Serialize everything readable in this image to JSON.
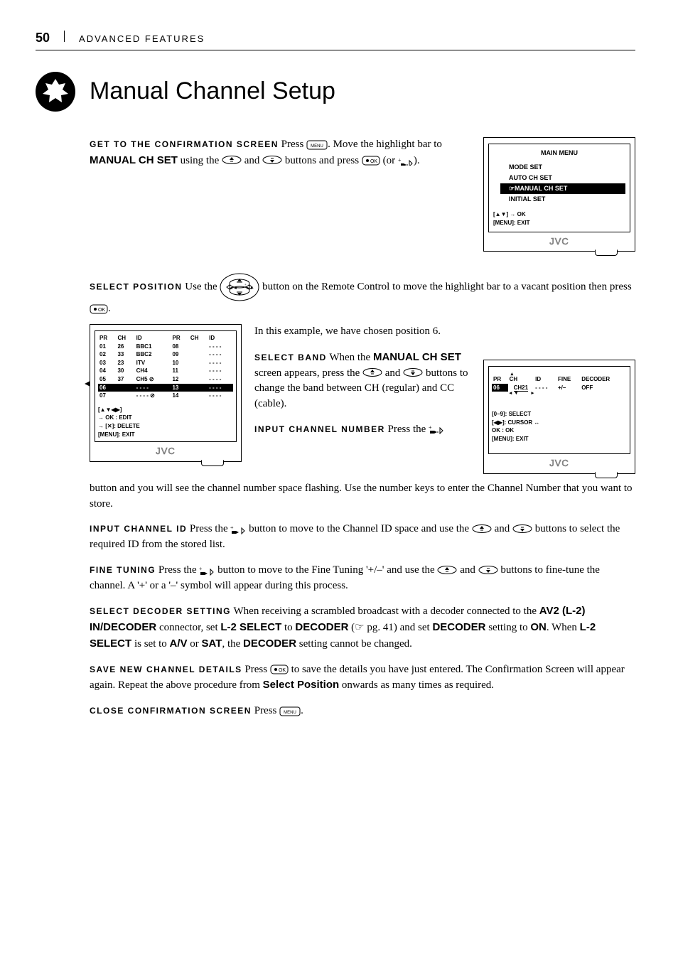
{
  "header": {
    "page_number": "50",
    "section": "ADVANCED FEATURES"
  },
  "title": "Manual Channel Setup",
  "step1": {
    "lead": "GET TO THE CONFIRMATION SCREEN",
    "t1": "Press ",
    "t2": ". Move the highlight bar to ",
    "bold1": "MANUAL CH SET",
    "t3": " using the ",
    "t4": " and ",
    "t5": " buttons and press ",
    "t6": " (or ",
    "t7": ")."
  },
  "screen_main": {
    "title": "MAIN MENU",
    "items": [
      "MODE SET",
      "AUTO CH SET",
      "MANUAL CH SET",
      "INITIAL SET"
    ],
    "hint1": "[▲▼] → OK",
    "hint2": "[MENU]: EXIT",
    "logo": "JVC"
  },
  "step2": {
    "lead": "SELECT POSITION",
    "t1": "Use the ",
    "t2": " button on the Remote Control to move the highlight bar to a vacant position then press ",
    "t3": ".",
    "t4": "In this example, we have chosen position 6."
  },
  "screen_list": {
    "headers": [
      "PR",
      "CH",
      "ID",
      "PR",
      "CH",
      "ID"
    ],
    "rows": [
      [
        "01",
        "26",
        "BBC1",
        "08",
        "",
        "- - - -"
      ],
      [
        "02",
        "33",
        "BBC2",
        "09",
        "",
        "- - - -"
      ],
      [
        "03",
        "23",
        "ITV",
        "10",
        "",
        "- - - -"
      ],
      [
        "04",
        "30",
        "CH4",
        "11",
        "",
        "- - - -"
      ],
      [
        "05",
        "37",
        "CH5 ⊘",
        "12",
        "",
        "- - - -"
      ]
    ],
    "hl_row": [
      "06",
      "",
      "- - - -",
      "13",
      "",
      "- - - -"
    ],
    "last_row": [
      "07",
      "",
      "- - - - ⊘",
      "14",
      "",
      "- - - -"
    ],
    "hint1": "[▲▼◀▶]",
    "hint2": "→ OK : EDIT",
    "hint3": "→ [✕]: DELETE",
    "hint4": "[MENU]: EXIT",
    "logo": "JVC"
  },
  "step3": {
    "lead": "SELECT BAND",
    "t1": "When the ",
    "bold1": "MANUAL CH SET",
    "t2": " screen appears, press the ",
    "t3": " and ",
    "t4": " buttons to change the band between CH (regular) and CC (cable)."
  },
  "step4": {
    "lead": "INPUT CHANNEL NUMBER",
    "t1": "Press the ",
    "t2": " button and you will see the channel number space flashing. Use the number keys to enter the Channel Number that you want to store."
  },
  "screen_edit": {
    "headers": [
      "PR",
      "CH",
      "ID",
      "FINE",
      "DECODER"
    ],
    "row": [
      "06",
      "CH21",
      "- - - -",
      "+/–",
      "OFF"
    ],
    "hint1": "[0–9]: SELECT",
    "hint2": "[◀▶]: CURSOR ↔",
    "hint3": "OK : OK",
    "hint4": "[MENU]: EXIT",
    "logo": "JVC"
  },
  "step5": {
    "lead": "INPUT CHANNEL ID",
    "t1": "Press the ",
    "t2": " button to move to the Channel ID space and use the ",
    "t3": " and ",
    "t4": " buttons to select the required ID from the stored list."
  },
  "step6": {
    "lead": "FINE TUNING",
    "t1": "Press the ",
    "t2": " button to move to the Fine Tuning '+/–' and use the ",
    "t3": " and ",
    "t4": " buttons to fine-tune the channel. A '+' or a '–' symbol will appear during this process."
  },
  "step7": {
    "lead": "SELECT DECODER SETTING",
    "t1": "When receiving a scrambled broadcast with a decoder connected to the ",
    "bold1": "AV2 (L-2) IN/DECODER",
    "t2": " connector, set ",
    "bold2": "L-2 SELECT",
    "t3": " to ",
    "bold3": "DECODER",
    "t4": " (☞ pg. 41) and set ",
    "bold4": "DECODER",
    "t5": " setting to ",
    "bold5": "ON",
    "t6": ". When ",
    "bold6": "L-2 SELECT",
    "t7": " is set to ",
    "bold7": "A/V",
    "t8": " or ",
    "bold8": "SAT",
    "t9": ", the ",
    "bold9": "DECODER",
    "t10": " setting cannot be changed."
  },
  "step8": {
    "lead": "SAVE NEW CHANNEL DETAILS",
    "t1": "Press ",
    "t2": " to save the details you have just entered.  The Confirmation Screen will appear again. Repeat the above procedure from ",
    "bold1": "Select Position",
    "t3": " onwards as many times as required."
  },
  "step9": {
    "lead": "CLOSE CONFIRMATION SCREEN",
    "t1": "Press ",
    "t2": "."
  }
}
